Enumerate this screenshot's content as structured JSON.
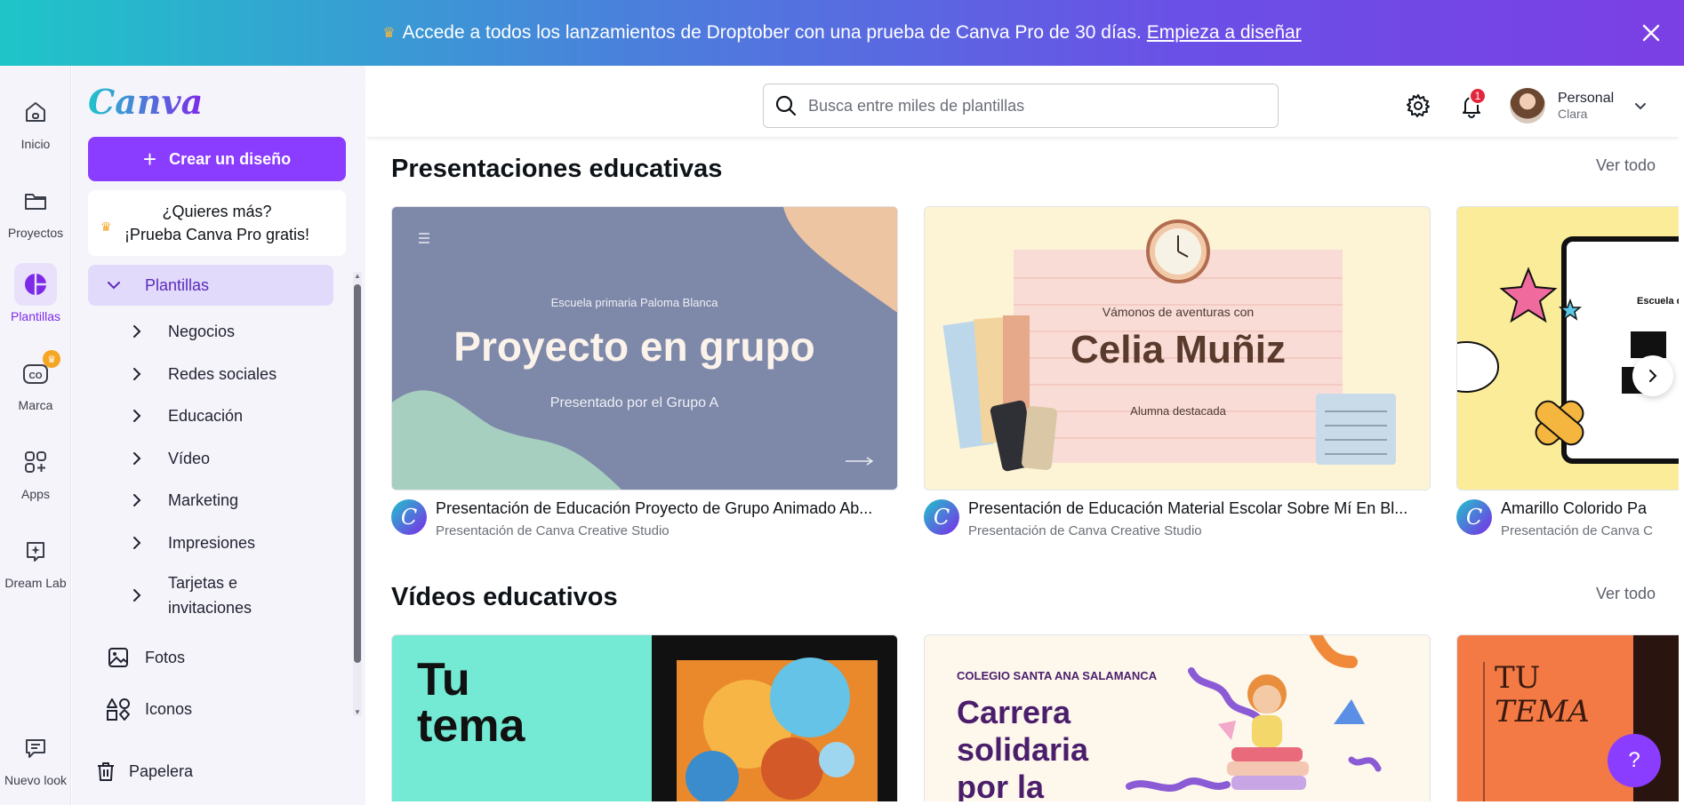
{
  "banner": {
    "text": "Accede a todos los lanzamientos de Droptober con una prueba de Canva Pro de 30 días.",
    "link": "Empieza a diseñar"
  },
  "rail": {
    "items": [
      {
        "label": "Inicio",
        "icon": "home-icon"
      },
      {
        "label": "Proyectos",
        "icon": "folder-icon"
      },
      {
        "label": "Plantillas",
        "icon": "templates-icon"
      },
      {
        "label": "Marca",
        "icon": "brand-icon"
      },
      {
        "label": "Apps",
        "icon": "apps-icon"
      },
      {
        "label": "Dream Lab",
        "icon": "dream-lab-icon"
      },
      {
        "label": "Nuevo look",
        "icon": "feedback-icon"
      }
    ]
  },
  "sidebar": {
    "logo": "Canva",
    "create_label": "Crear un diseño",
    "promo_line1": "¿Quieres más?",
    "promo_line2": "¡Prueba Canva Pro gratis!",
    "templates_label": "Plantillas",
    "categories": [
      "Negocios",
      "Redes sociales",
      "Educación",
      "Vídeo",
      "Marketing",
      "Impresiones",
      "Tarjetas e invitaciones"
    ],
    "photos_label": "Fotos",
    "icons_label": "Iconos",
    "trash_label": "Papelera"
  },
  "topbar": {
    "search_placeholder": "Busca entre miles de plantillas",
    "notifications_count": "1",
    "account_name": "Personal",
    "account_user": "Clara"
  },
  "sections": [
    {
      "title": "Presentaciones educativas",
      "see_all": "Ver todo",
      "cards": [
        {
          "title": "Presentación de Educación Proyecto de Grupo Animado Ab...",
          "subtitle": "Presentación de Canva Creative Studio",
          "thumb_school": "Escuela primaria Paloma Blanca",
          "thumb_heading": "Proyecto en grupo",
          "thumb_sub": "Presentado por el Grupo A"
        },
        {
          "title": "Presentación de Educación Material Escolar Sobre Mí En Bl...",
          "subtitle": "Presentación de Canva Creative Studio",
          "thumb_kicker": "Vámonos de aventuras con",
          "thumb_heading": "Celia Muñiz",
          "thumb_sub": "Alumna destacada"
        },
        {
          "title": "Amarillo Colorido Pa",
          "subtitle": "Presentación de Canva C",
          "thumb_school": "Escuela d"
        }
      ]
    },
    {
      "title": "Vídeos educativos",
      "see_all": "Ver todo",
      "cards": [
        {
          "thumb_line1": "Tu",
          "thumb_line2": "tema"
        },
        {
          "thumb_school": "COLEGIO SANTA ANA SALAMANCA",
          "thumb_line1": "Carrera",
          "thumb_line2": "solidaria",
          "thumb_line3": "por la"
        },
        {
          "thumb_line1": "TU",
          "thumb_line2": "TEMA"
        }
      ]
    }
  ],
  "help_label": "?",
  "colors": {
    "brand_purple": "#8b3dff",
    "accent_teal": "#20c4cb",
    "notification_red": "#e2263d"
  }
}
